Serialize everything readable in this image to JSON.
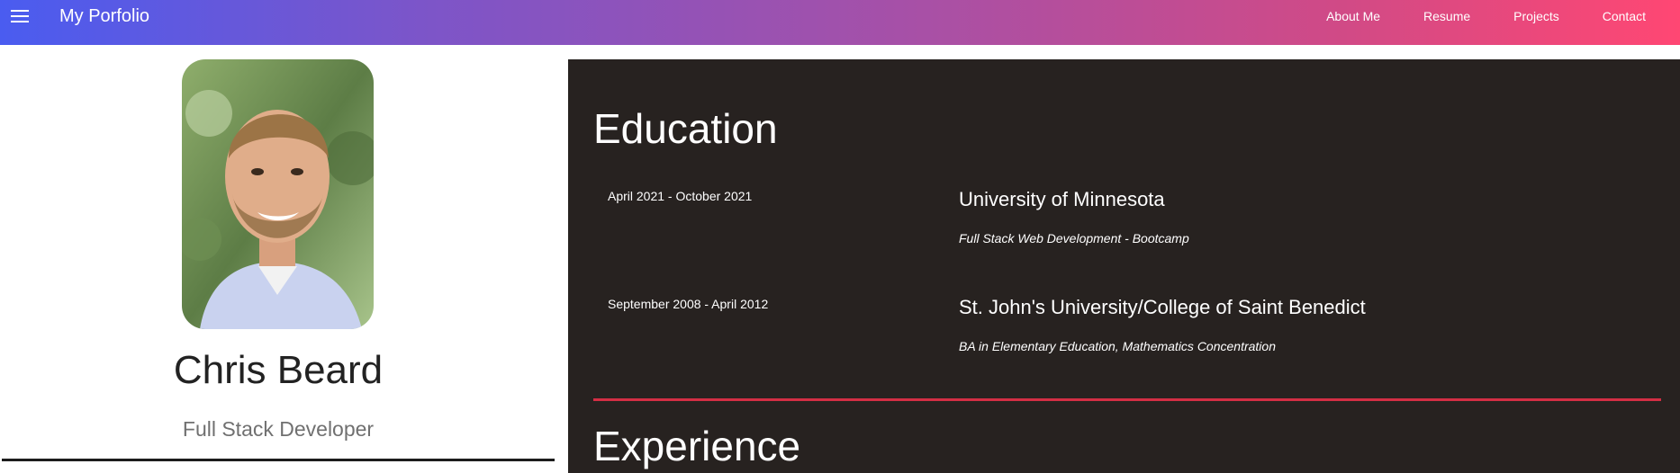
{
  "header": {
    "brand": "My Porfolio",
    "menu_icon": "hamburger-menu-icon",
    "nav": [
      {
        "label": "About Me"
      },
      {
        "label": "Resume"
      },
      {
        "label": "Projects"
      },
      {
        "label": "Contact"
      }
    ],
    "gradient_start": "#4a5cf0",
    "gradient_end": "#ff4773"
  },
  "profile": {
    "name": "Chris Beard",
    "role": "Full Stack Developer"
  },
  "education": {
    "title": "Education",
    "entries": [
      {
        "date": "April 2021 - October 2021",
        "school": "University of Minnesota",
        "detail": "Full Stack Web Development - Bootcamp"
      },
      {
        "date": "September 2008 - April 2012",
        "school": "St. John's University/College of Saint Benedict",
        "detail": "BA in Elementary Education, Mathematics Concentration"
      }
    ]
  },
  "experience": {
    "title": "Experience"
  },
  "colors": {
    "panel_background": "#272220",
    "divider_accent": "#d42e44"
  }
}
